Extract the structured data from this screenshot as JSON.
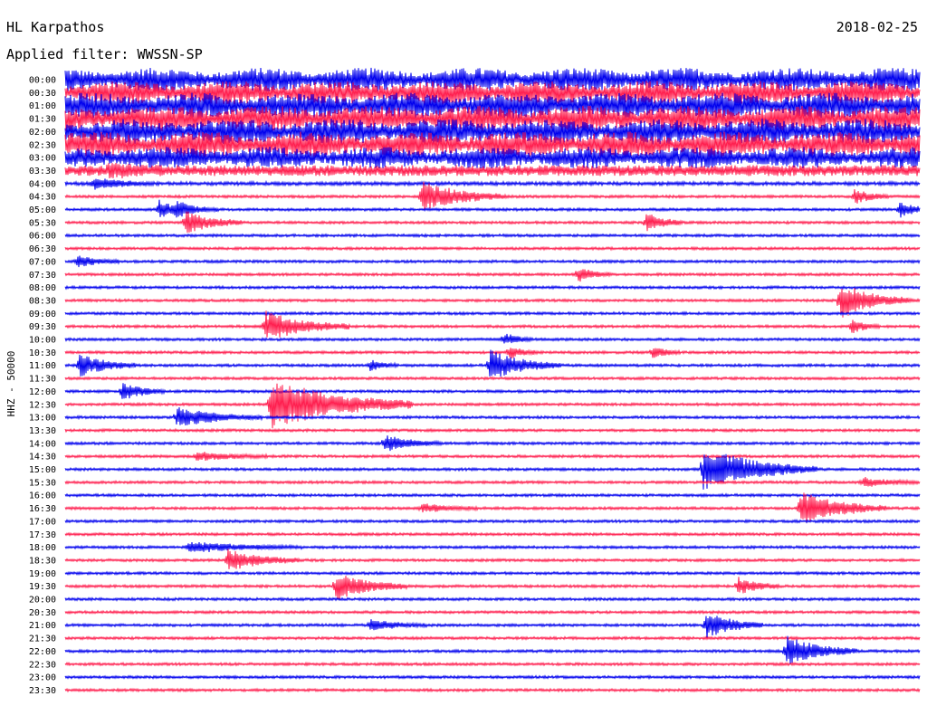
{
  "header": {
    "station": "HL Karpathos",
    "date": "2018-02-25",
    "filter": "Applied filter: WWSSN-SP"
  },
  "chart_data": {
    "type": "line",
    "title": "",
    "ylabel": "HHZ - 50000",
    "xlabel": "",
    "grid": false,
    "legend": "none",
    "trace_colors": [
      "#0000ee",
      "#ff1f4f"
    ],
    "row_labels": [
      "00:00",
      "00:30",
      "01:00",
      "01:30",
      "02:00",
      "02:30",
      "03:00",
      "03:30",
      "04:00",
      "04:30",
      "05:00",
      "05:30",
      "06:00",
      "06:30",
      "07:00",
      "07:30",
      "08:00",
      "08:30",
      "09:00",
      "09:30",
      "10:00",
      "10:30",
      "11:00",
      "11:30",
      "12:00",
      "12:30",
      "13:00",
      "13:30",
      "14:00",
      "14:30",
      "15:00",
      "15:30",
      "16:00",
      "16:30",
      "17:00",
      "17:30",
      "18:00",
      "18:30",
      "19:00",
      "19:30",
      "20:00",
      "20:30",
      "21:00",
      "21:30",
      "22:00",
      "22:30",
      "23:00",
      "23:30"
    ],
    "x_range_minutes": [
      0,
      30
    ],
    "noise_levels": [
      22,
      22,
      24,
      24,
      24,
      24,
      20,
      12,
      4,
      3,
      3,
      3,
      3,
      3,
      3,
      3,
      3,
      3,
      3,
      3,
      3,
      3,
      3,
      3,
      3,
      3,
      3,
      3,
      3,
      3,
      3,
      3,
      3,
      3,
      3,
      3,
      3,
      3,
      3,
      3,
      3,
      3,
      3,
      3,
      3,
      3,
      3,
      3
    ],
    "events": [
      {
        "row": 7,
        "minute": 1.5,
        "amplitude": 10,
        "duration": 2
      },
      {
        "row": 8,
        "minute": 1,
        "amplitude": 12,
        "duration": 2
      },
      {
        "row": 9,
        "minute": 12.5,
        "amplitude": 34,
        "duration": 3
      },
      {
        "row": 10,
        "minute": 3.3,
        "amplitude": 20,
        "duration": 1.2
      },
      {
        "row": 10,
        "minute": 3.9,
        "amplitude": 16,
        "duration": 1.5
      },
      {
        "row": 11,
        "minute": 4.2,
        "amplitude": 26,
        "duration": 2
      },
      {
        "row": 11,
        "minute": 20.4,
        "amplitude": 22,
        "duration": 1.3
      },
      {
        "row": 10,
        "minute": 29.3,
        "amplitude": 18,
        "duration": 1
      },
      {
        "row": 9,
        "minute": 27.7,
        "amplitude": 18,
        "duration": 1.2
      },
      {
        "row": 14,
        "minute": 0.4,
        "amplitude": 14,
        "duration": 1.5
      },
      {
        "row": 15,
        "minute": 18,
        "amplitude": 16,
        "duration": 1.2
      },
      {
        "row": 17,
        "minute": 27.2,
        "amplitude": 40,
        "duration": 2.5
      },
      {
        "row": 19,
        "minute": 7,
        "amplitude": 34,
        "duration": 3
      },
      {
        "row": 19,
        "minute": 27.6,
        "amplitude": 16,
        "duration": 1
      },
      {
        "row": 20,
        "minute": 15.4,
        "amplitude": 14,
        "duration": 1
      },
      {
        "row": 21,
        "minute": 15.6,
        "amplitude": 14,
        "duration": 1
      },
      {
        "row": 21,
        "minute": 20.6,
        "amplitude": 14,
        "duration": 1
      },
      {
        "row": 22,
        "minute": 14.9,
        "amplitude": 34,
        "duration": 2.5
      },
      {
        "row": 22,
        "minute": 0.5,
        "amplitude": 26,
        "duration": 2
      },
      {
        "row": 22,
        "minute": 10.7,
        "amplitude": 12,
        "duration": 1
      },
      {
        "row": 24,
        "minute": 2,
        "amplitude": 20,
        "duration": 1.5
      },
      {
        "row": 25,
        "minute": 7.2,
        "amplitude": 60,
        "duration": 5
      },
      {
        "row": 26,
        "minute": 3.9,
        "amplitude": 22,
        "duration": 3
      },
      {
        "row": 28,
        "minute": 11.2,
        "amplitude": 18,
        "duration": 2
      },
      {
        "row": 29,
        "minute": 4.6,
        "amplitude": 10,
        "duration": 2.5
      },
      {
        "row": 30,
        "minute": 22.4,
        "amplitude": 50,
        "duration": 4
      },
      {
        "row": 33,
        "minute": 25.8,
        "amplitude": 38,
        "duration": 3
      },
      {
        "row": 33,
        "minute": 12.5,
        "amplitude": 10,
        "duration": 2
      },
      {
        "row": 31,
        "minute": 28,
        "amplitude": 10,
        "duration": 2
      },
      {
        "row": 36,
        "minute": 4.3,
        "amplitude": 12,
        "duration": 4
      },
      {
        "row": 37,
        "minute": 5.7,
        "amplitude": 24,
        "duration": 2.5
      },
      {
        "row": 39,
        "minute": 9.5,
        "amplitude": 30,
        "duration": 2.5
      },
      {
        "row": 39,
        "minute": 23.6,
        "amplitude": 20,
        "duration": 1.5
      },
      {
        "row": 42,
        "minute": 10.7,
        "amplitude": 12,
        "duration": 2
      },
      {
        "row": 42,
        "minute": 22.5,
        "amplitude": 30,
        "duration": 2
      },
      {
        "row": 44,
        "minute": 25.3,
        "amplitude": 34,
        "duration": 2.5
      }
    ]
  }
}
